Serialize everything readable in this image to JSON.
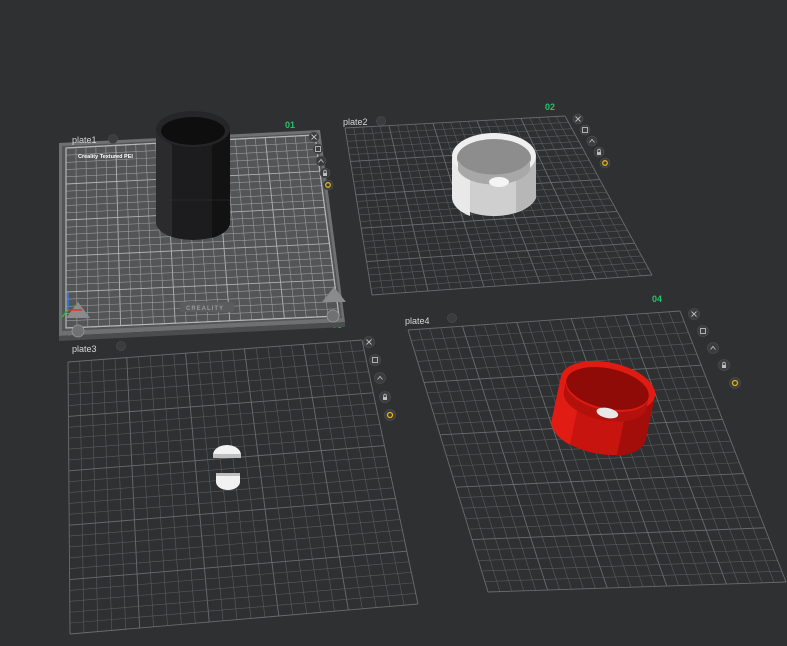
{
  "plates": [
    {
      "name": "plate1",
      "number": "01",
      "bed_brand": "Creality Textured PEI",
      "bed_logo": "CREALITY"
    },
    {
      "name": "plate2",
      "number": "02"
    },
    {
      "name": "plate3",
      "number": "03"
    },
    {
      "name": "plate4",
      "number": "04"
    }
  ],
  "plate_toolbar_icons": [
    "close-icon",
    "arrange-icon",
    "orient-icon",
    "lock-icon",
    "settings-icon"
  ],
  "colors": {
    "background": "#2f3032",
    "grid": "#5a5b5e",
    "plate_number": "#25c26a",
    "active_icon": "#e3b21a",
    "model_plate1": "#1c1c1e",
    "model_plate2": "#d9d9d9",
    "model_plate3": "#f2f2f2",
    "model_plate4": "#c8140e"
  }
}
